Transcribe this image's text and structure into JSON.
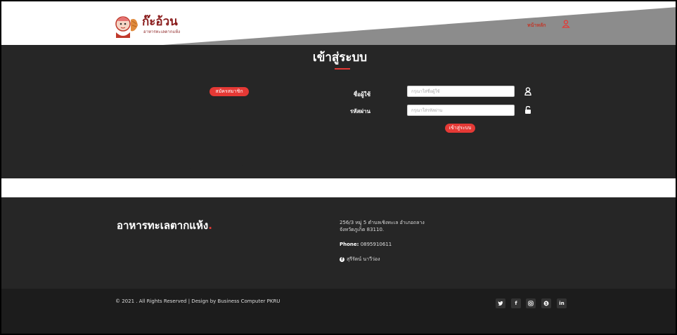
{
  "header": {
    "logo_title": "ก๊ะอ้วน",
    "logo_subtitle": "อาหารทะเลตากแห้ง",
    "nav_home": "หน้าหลัก",
    "user_icon": "user-icon"
  },
  "login": {
    "title": "เข้าสู่ระบบ",
    "register_label": "สมัครสมาชิก",
    "username_label": "ชื่อผู้ใช้",
    "username_placeholder": "กรุณาใส่ชื่อผู้ใช้",
    "password_label": "รหัสผ่าน",
    "password_placeholder": "กรุณาใส่รหัสผ่าน",
    "submit_label": "เข้าสู่ระบบ",
    "user_icon": "user-icon",
    "lock_icon": "lock-open-icon"
  },
  "footer": {
    "brand": "อาหารทะเลตากแห้ง",
    "brand_dot": ".",
    "address_line1": "256/3 หมู่ 5 ตำบลเชิงทะเล อำเภอถลาง",
    "address_line2": "จังหวัดภูเก็ต 83110.",
    "phone_label": "Phone:",
    "phone_value": "0895910611",
    "owner_name": "สุรีรัตน์ นาวีว่อง",
    "copyright": "© 2021 . All Rights Reserved | Design by Business Computer PKRU",
    "social": [
      "twitter-icon",
      "facebook-icon",
      "instagram-icon",
      "skype-icon",
      "linkedin-icon"
    ],
    "social_glyphs": [
      "🐦",
      "f",
      "◎",
      "S",
      "in"
    ]
  },
  "colors": {
    "accent": "#e53935",
    "dark": "#262626",
    "header_gray": "#8c8c8c",
    "white": "#ffffff"
  }
}
